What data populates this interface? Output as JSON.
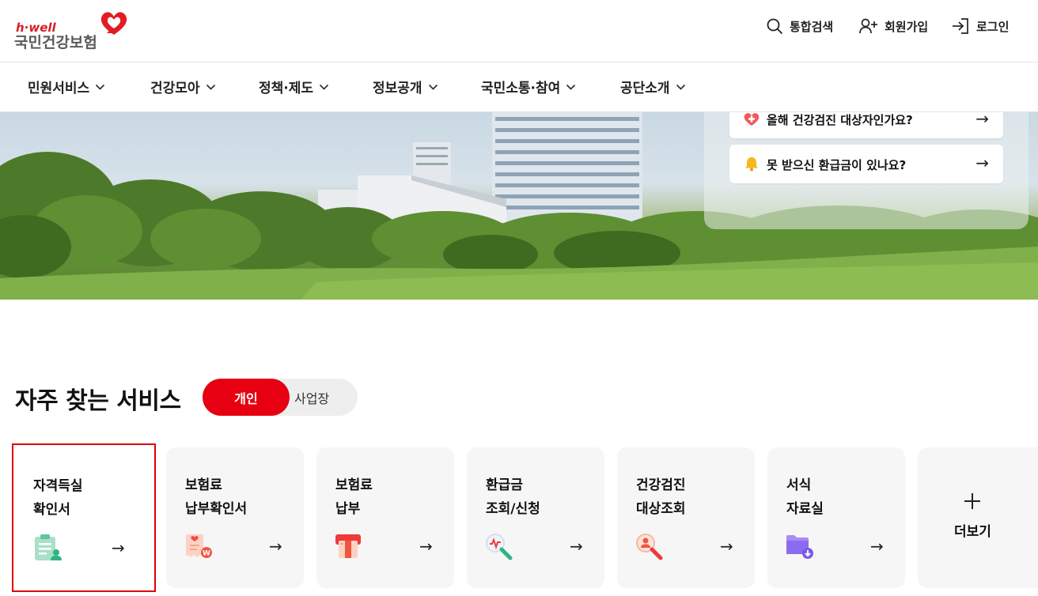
{
  "header": {
    "brand_small": "h·well",
    "brand_name": "국민건강보험",
    "utils": [
      {
        "label": "통합검색",
        "icon": "search-icon"
      },
      {
        "label": "회원가입",
        "icon": "user-plus-icon"
      },
      {
        "label": "로그인",
        "icon": "login-icon"
      }
    ]
  },
  "gnb": [
    {
      "label": "민원서비스"
    },
    {
      "label": "건강모아"
    },
    {
      "label": "정책·제도"
    },
    {
      "label": "정보공개"
    },
    {
      "label": "국민소통·참여"
    },
    {
      "label": "공단소개"
    }
  ],
  "hero": {
    "quick_links": [
      {
        "label": "올해 건강검진 대상자인가요?",
        "icon": "heart-cross-icon"
      },
      {
        "label": "못 받으신 환급금이 있나요?",
        "icon": "bell-icon"
      }
    ]
  },
  "services": {
    "title": "자주 찾는 서비스",
    "toggle": {
      "active": "개인",
      "inactive": "사업장"
    },
    "cards": [
      {
        "line1": "자격득실",
        "line2": "확인서",
        "icon": "certificate-icon"
      },
      {
        "line1": "보험료",
        "line2": "납부확인서",
        "icon": "receipt-icon"
      },
      {
        "line1": "보험료",
        "line2": "납부",
        "icon": "card-payment-icon"
      },
      {
        "line1": "환급금",
        "line2": "조회/신청",
        "icon": "search-refund-icon"
      },
      {
        "line1": "건강검진",
        "line2": "대상조회",
        "icon": "search-person-icon"
      },
      {
        "line1": "서식",
        "line2": "자료실",
        "icon": "folder-download-icon"
      }
    ],
    "more": {
      "label": "더보기"
    }
  },
  "colors": {
    "brand_red": "#e60012",
    "selected_border": "#e00000",
    "card_bg": "#f6f6f6"
  }
}
